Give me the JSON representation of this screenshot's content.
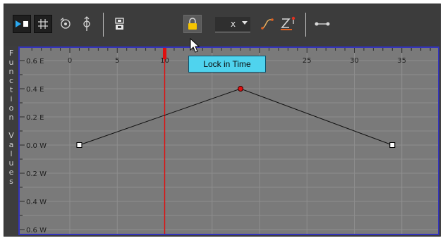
{
  "toolbar": {
    "buttons": [
      {
        "name": "play-icon",
        "pressed": true
      },
      {
        "name": "grid-icon",
        "pressed": true
      },
      {
        "name": "rotate-icon"
      },
      {
        "name": "pivot-icon"
      },
      {
        "name": "snap-to-keyframe-icon"
      },
      {
        "name": "lock-in-time-icon",
        "active": true
      },
      {
        "name": "ease-curve-icon"
      },
      {
        "name": "z-key-icon"
      },
      {
        "name": "link-icon"
      }
    ],
    "channel_dropdown": {
      "value": "x"
    }
  },
  "tooltip": {
    "text": "Lock in Time"
  },
  "sidebar": {
    "label": "Function Values"
  },
  "graph": {
    "x_ticks": [
      "0",
      "5",
      "10",
      "15",
      "20",
      "25",
      "30",
      "35"
    ],
    "y_ticks": [
      "0.6 E",
      "0.4 E",
      "0.2 E",
      "0.0 W",
      "0.2 W",
      "0.4 W",
      "0.6 W"
    ],
    "current_frame": 10,
    "keyframes": [
      {
        "frame": 1,
        "value": 0.0,
        "selected": false
      },
      {
        "frame": 18,
        "value": 0.4,
        "selected": true
      },
      {
        "frame": 34,
        "value": 0.0,
        "selected": false
      }
    ],
    "colors": {
      "background": "#7a7a7a",
      "grid": "#8e8e8e",
      "curve": "#111111",
      "playhead": "#e01010",
      "selected_key": "#e01010",
      "key": "#ffffff",
      "border": "#3333bb"
    }
  }
}
